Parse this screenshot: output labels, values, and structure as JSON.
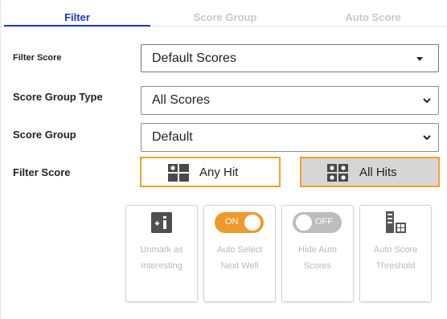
{
  "tabs": [
    {
      "label": "Filter",
      "active": true
    },
    {
      "label": "Score Group",
      "active": false
    },
    {
      "label": "Auto Score",
      "active": false
    }
  ],
  "form": {
    "filter_score_label": "Filter Score",
    "filter_score_value": "Default Scores",
    "score_group_type_label": "Score Group Type",
    "score_group_type_value": "All Scores",
    "score_group_label": "Score Group",
    "score_group_value": "Default",
    "hit_filter_label": "Filter Score"
  },
  "hit_buttons": {
    "any_hit": {
      "label": "Any Hit",
      "selected": false
    },
    "all_hits": {
      "label": "All Hits",
      "selected": true
    }
  },
  "tiles": [
    {
      "label": "Unmark as Interesting",
      "icon": "unmark-interesting-icon"
    },
    {
      "label": "Auto Select Next Well",
      "toggle": "ON",
      "icon": "toggle-on-icon"
    },
    {
      "label": "Hide Auto Scores",
      "toggle": "OFF",
      "icon": "toggle-off-icon"
    },
    {
      "label": "Auto Score Threshold",
      "icon": "threshold-icon"
    }
  ],
  "colors": {
    "active_tab": "#1a35c8",
    "accent_border": "#f0a12b",
    "toggle_on": "#ef9a2c",
    "toggle_off": "#bdbdbd",
    "selected_button_bg": "#d6d6d6"
  }
}
